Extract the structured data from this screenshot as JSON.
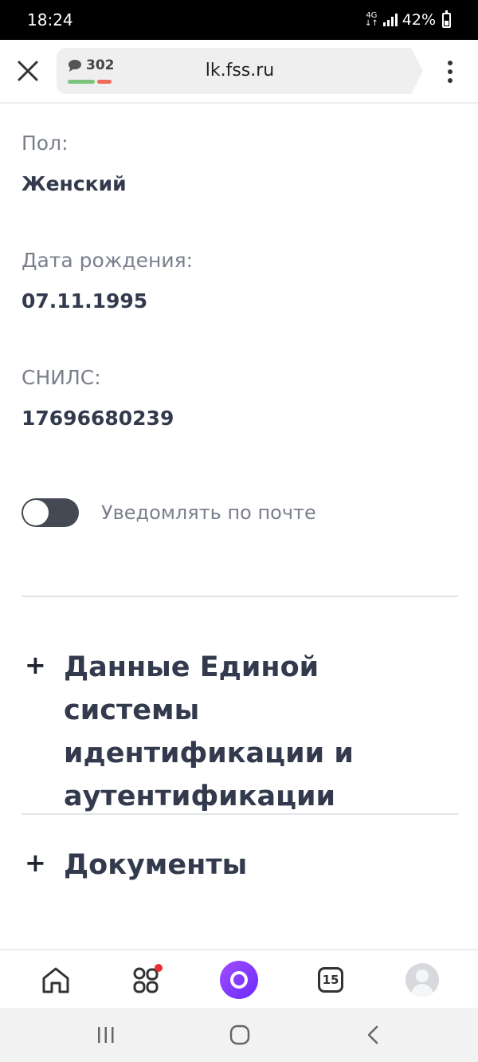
{
  "status_bar": {
    "time": "18:24",
    "network": "4G",
    "battery": "42%"
  },
  "browser": {
    "reviews_count": "302",
    "url": "lk.fss.ru"
  },
  "profile": {
    "gender_label": "Пол:",
    "gender_value": "Женский",
    "birth_label": "Дата рождения:",
    "birth_value": "07.11.1995",
    "snils_label": "СНИЛС:",
    "snils_value": "17696680239"
  },
  "notify": {
    "label": "Уведомлять по почте",
    "enabled": false
  },
  "sections": [
    {
      "plus": "+",
      "title": "Данные Единой системы идентификации и аутентификации"
    },
    {
      "plus": "+",
      "title": "Документы"
    }
  ],
  "toolbar": {
    "tabs_count": "15"
  },
  "icons": {
    "close": "close-icon",
    "comment": "comment-icon",
    "menu": "more-vert-icon",
    "home": "home-icon",
    "services": "grid-icon",
    "alice": "alice-icon",
    "tabs": "tabs-icon",
    "profile": "avatar-icon"
  },
  "colors": {
    "text_primary": "#333a4d",
    "text_secondary": "#7a7f8c",
    "toggle_off": "#444954",
    "alice_gradient": "#8a3dff",
    "badge_dot": "#e8302d",
    "rating_good": "#7cc47e",
    "rating_bad": "#ef6b5b"
  }
}
